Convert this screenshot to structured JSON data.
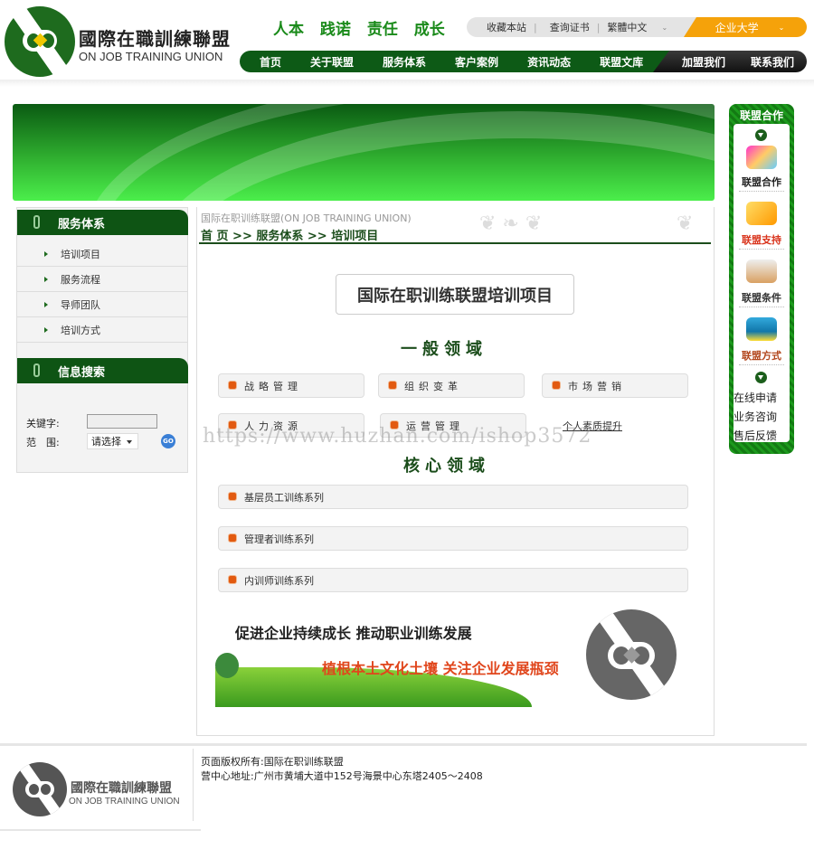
{
  "header": {
    "logo_cn": "國際在職訓練聯盟",
    "logo_en": "ON JOB TRAINING UNION",
    "tagline": "人本 践诺 责任 成长",
    "top_links": [
      "收藏本站",
      "查询证书",
      "繁體中文"
    ],
    "university_label": "企业大学",
    "nav": [
      "首页",
      "关于联盟",
      "服务体系",
      "客户案例",
      "资讯动态",
      "联盟文库"
    ],
    "nav_dark": [
      "加盟我们",
      "联系我们"
    ]
  },
  "sidebar": {
    "service_title": "服务体系",
    "service_items": [
      "培训项目",
      "服务流程",
      "导师团队",
      "培训方式"
    ],
    "search_title": "信息搜索",
    "keyword_label": "关键字:",
    "keyword_value": "",
    "scope_label": "范　围:",
    "scope_selected": "请选择",
    "go_label": "GO"
  },
  "main": {
    "site_line": "国际在职训练联盟(ON JOB TRAINING UNION)",
    "breadcrumb": "首 页 >> 服务体系 >> 培训项目",
    "page_title": "国际在职训练联盟培训项目",
    "general_title": "一般领域",
    "general_items": [
      "战略管理",
      "组织变革",
      "市场营销",
      "人力资源",
      "运营管理"
    ],
    "personal_link": "个人素质提升",
    "core_title": "核心领域",
    "core_items": [
      "基层员工训练系列",
      "管理者训练系列",
      "内训师训练系列"
    ],
    "slogan1": "促进企业持续成长  推动职业训练发展",
    "slogan2": "植根本土文化土壤  关注企业发展瓶颈",
    "watermark": "https://www.huzhan.com/ishop3572"
  },
  "right_panel": {
    "title": "联盟合作",
    "items": [
      {
        "label": "联盟合作",
        "color": "#222222"
      },
      {
        "label": "联盟支持",
        "color": "#d9341c"
      },
      {
        "label": "联盟条件",
        "color": "#333333"
      },
      {
        "label": "联盟方式",
        "color": "#b2461c"
      }
    ],
    "links": [
      "在线申请",
      "业务咨询",
      "售后反馈"
    ]
  },
  "footer": {
    "logo_cn": "國際在職訓練聯盟",
    "logo_en": "ON JOB TRAINING UNION",
    "copyright": "页面版权所有:国际在职训练联盟",
    "address": "营中心地址:广州市黄埔大道中152号海景中心东塔2405～2408"
  },
  "colors": {
    "brand_green": "#0d5a16",
    "accent_orange": "#f5a20a",
    "bullet_orange": "#e25a10"
  }
}
